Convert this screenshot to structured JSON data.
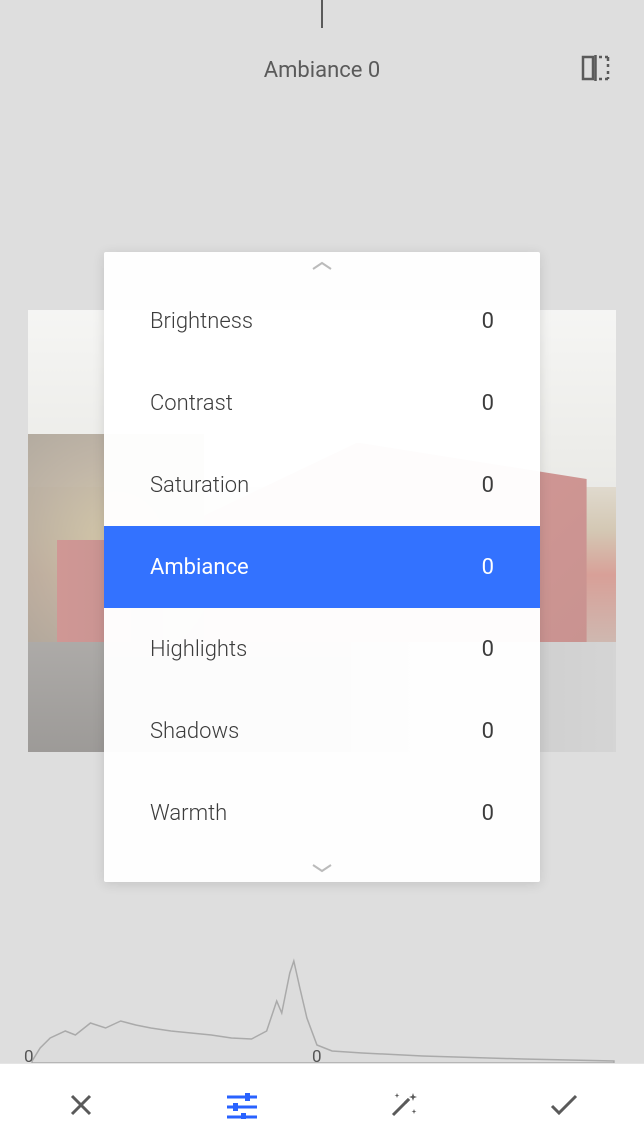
{
  "header": {
    "title": "Ambiance 0"
  },
  "adjustments": [
    {
      "label": "Brightness",
      "value": "0",
      "selected": false
    },
    {
      "label": "Contrast",
      "value": "0",
      "selected": false
    },
    {
      "label": "Saturation",
      "value": "0",
      "selected": false
    },
    {
      "label": "Ambiance",
      "value": "0",
      "selected": true
    },
    {
      "label": "Highlights",
      "value": "0",
      "selected": false
    },
    {
      "label": "Shadows",
      "value": "0",
      "selected": false
    },
    {
      "label": "Warmth",
      "value": "0",
      "selected": false
    }
  ],
  "histogram": {
    "left_label": "0",
    "right_label": "0"
  },
  "icons": {
    "compare": "compare-icon",
    "close": "close-icon",
    "tune": "tune-icon",
    "magic": "magic-wand-icon",
    "apply": "checkmark-icon",
    "chevron_up": "chevron-up-icon",
    "chevron_down": "chevron-down-icon"
  }
}
